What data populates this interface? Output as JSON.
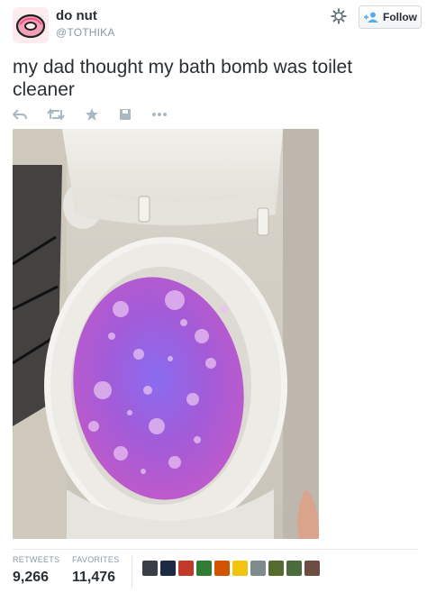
{
  "tweet": {
    "display_name": "do nut",
    "handle": "@TOTHIKA",
    "text": "my dad thought my bath bomb was toilet cleaner",
    "follow_label": "Follow",
    "avatar_icon": "donut-icon",
    "action_icons": [
      "reply-icon",
      "retweet-icon",
      "favorite-icon",
      "save-icon",
      "more-icon"
    ],
    "photo_description_icon": "toilet-bath-bomb-photo"
  },
  "stats": {
    "retweets_label": "RETWEETS",
    "retweets_value": "9,266",
    "favorites_label": "FAVORITES",
    "favorites_value": "11,476"
  },
  "favoriters": {
    "avatar_colors": [
      "#3a3f47",
      "#1c2a44",
      "#c0392b",
      "#2e7d32",
      "#d35400",
      "#f1c40f",
      "#7f8c8d",
      "#556b2f",
      "#4a6b3a",
      "#6d4c41"
    ]
  },
  "colors": {
    "link_gray": "#8899a6",
    "text": "#292f33",
    "water": "#9b59d0"
  }
}
